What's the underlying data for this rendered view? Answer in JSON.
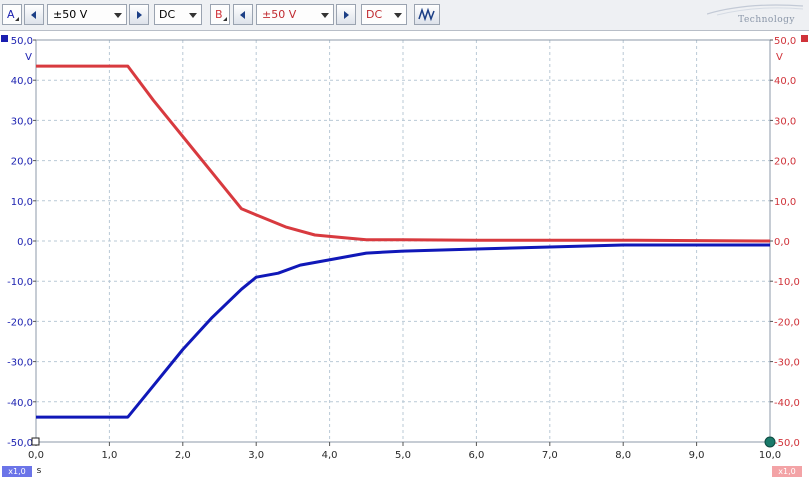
{
  "toolbar": {
    "channel_a": {
      "letter": "A",
      "range": "±50 V",
      "coupling": "DC",
      "color": "#1a1fb0"
    },
    "channel_b": {
      "letter": "B",
      "range": "±50 V",
      "coupling": "DC",
      "color": "#d0333a"
    },
    "signal_icon": "signal-generator-icon",
    "logo_text": "Technology"
  },
  "footer": {
    "left_zoom": "x1,0",
    "right_zoom": "x1,0",
    "x_unit": "s"
  },
  "chart_data": {
    "type": "line",
    "xlim": [
      0,
      10
    ],
    "ylim": [
      -50,
      50
    ],
    "x_ticks": [
      "0,0",
      "1,0",
      "2,0",
      "3,0",
      "4,0",
      "5,0",
      "6,0",
      "7,0",
      "8,0",
      "9,0",
      "10,0"
    ],
    "y_ticks_left": [
      "50,0",
      "40,0",
      "30,0",
      "20,0",
      "10,0",
      "0,0",
      "-10,0",
      "-20,0",
      "-30,0",
      "-40,0",
      "-50,0"
    ],
    "y_ticks_right": [
      "50,0",
      "40,0",
      "30,0",
      "20,0",
      "10,0",
      "0,0",
      "-10,0",
      "-20,0",
      "-30,0",
      "-40,0",
      "-50,0"
    ],
    "y_tick_values": [
      50,
      40,
      30,
      20,
      10,
      0,
      -10,
      -20,
      -30,
      -40,
      -50
    ],
    "x_tick_values": [
      0,
      1,
      2,
      3,
      4,
      5,
      6,
      7,
      8,
      9,
      10
    ],
    "ylabel_left": "V",
    "ylabel_right": "V",
    "xlabel": "s",
    "grid": true,
    "series": [
      {
        "color": "#d83a3f",
        "x": [
          0,
          1.25,
          1.6,
          2.0,
          2.4,
          2.8,
          3.0,
          3.4,
          3.8,
          4.2,
          4.5,
          5.0,
          6.0,
          7.0,
          8.0,
          9.0,
          10.0
        ],
        "y": [
          43.5,
          43.5,
          35,
          26,
          17,
          8,
          6.5,
          3.5,
          1.5,
          0.8,
          0.3,
          0.3,
          0.2,
          0.2,
          0.2,
          0.1,
          0
        ]
      },
      {
        "color": "#1018b8",
        "x": [
          0,
          1.25,
          1.6,
          2.0,
          2.4,
          2.8,
          3.0,
          3.3,
          3.6,
          3.9,
          4.2,
          4.5,
          5.0,
          6.0,
          7.0,
          8.0,
          9.0,
          10.0
        ],
        "y": [
          -43.8,
          -43.8,
          -36,
          -27,
          -19,
          -12,
          -9,
          -8,
          -6,
          -5,
          -4,
          -3,
          -2.5,
          -2,
          -1.5,
          -1,
          -1,
          -1
        ]
      }
    ]
  }
}
